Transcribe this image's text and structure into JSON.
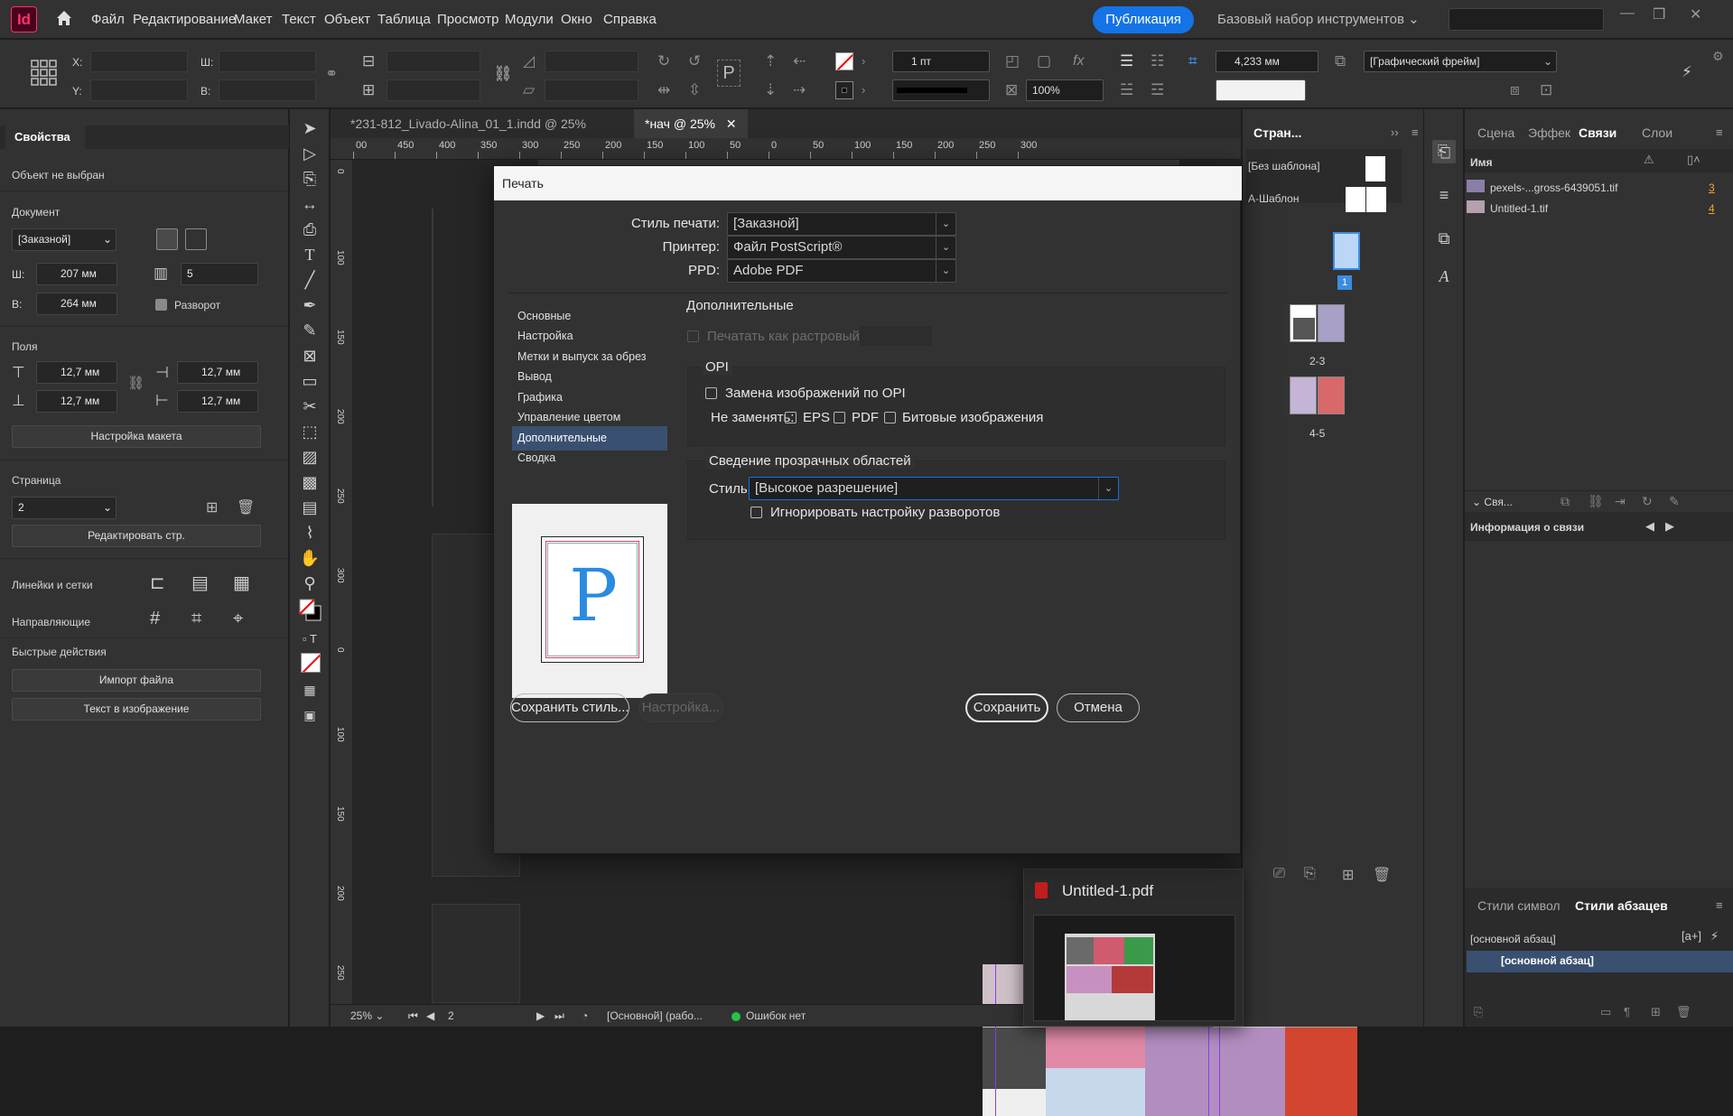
{
  "app": {
    "logo": "Id",
    "accent": "#ff3366"
  },
  "menu": {
    "items": [
      "Файл",
      "Редактирование",
      "Макет",
      "Текст",
      "Объект",
      "Таблица",
      "Просмотр",
      "Модули",
      "Окно",
      "Справка"
    ],
    "publish": "Публикация",
    "workspace": "Базовый набор инструментов"
  },
  "control": {
    "x_label": "X:",
    "y_label": "Y:",
    "w_label": "Ш:",
    "h_label": "В:",
    "stroke_weight": "1 пт",
    "zoom_pct": "100%",
    "gutter": "4,233 мм",
    "frame_style": "[Графический фрейм]"
  },
  "properties": {
    "tab": "Свойства",
    "status": "Объект не выбран",
    "document_heading": "Документ",
    "preset": "[Заказной]",
    "w_label": "Ш:",
    "w_value": "207 мм",
    "h_label": "В:",
    "h_value": "264 мм",
    "pages_value": "5",
    "spread_label": "Разворот",
    "margins_heading": "Поля",
    "margin_top": "12,7 мм",
    "margin_bottom": "12,7 мм",
    "margin_left": "12,7 мм",
    "margin_right": "12,7 мм",
    "layout_btn": "Настройка макета",
    "page_heading": "Страница",
    "page_value": "2",
    "edit_page_btn": "Редактировать стр.",
    "rulers_heading": "Линейки и сетки",
    "guides_heading": "Направляющие",
    "quick_heading": "Быстрые действия",
    "import_btn": "Импорт файла",
    "text_image_btn": "Текст в изображение"
  },
  "tabs": [
    {
      "label": "*231-812_Livado-Alina_01_1.indd @ 25%"
    },
    {
      "label": "*нач @ 25%"
    }
  ],
  "ruler": {
    "h_labels": [
      "00",
      "450",
      "400",
      "350",
      "300",
      "250",
      "200",
      "150",
      "100",
      "50",
      "0",
      "50",
      "100",
      "150",
      "200",
      "250",
      "300"
    ]
  },
  "status": {
    "zoom": "25%",
    "page": "2",
    "style": "[Основной] (рабо...",
    "errors": "Ошибок нет"
  },
  "pages_panel": {
    "title": "Стран...",
    "none_master": "[Без шаблона]",
    "a_master": "А-Шаблон",
    "labels": [
      "1",
      "2-3",
      "4-5"
    ]
  },
  "links_panel": {
    "tabs": [
      "Сцена",
      "Эффек",
      "Связи",
      "Слои"
    ],
    "col_name": "Имя",
    "files": [
      {
        "name": "pexels-...gross-6439051.tif",
        "page": "3"
      },
      {
        "name": "Untitled-1.tif",
        "page": "4"
      }
    ],
    "section_short": "Свя...",
    "link_info": "Информация о связи"
  },
  "styles_panel": {
    "tabs": [
      "Стили символ",
      "Стили абзацев"
    ],
    "current": "[основной абзац]",
    "item": "[основной абзац]"
  },
  "dialog": {
    "title": "Печать",
    "style_label": "Стиль печати:",
    "style_value": "[Заказной]",
    "printer_label": "Принтер:",
    "printer_value": "Файл PostScript®",
    "ppd_label": "PPD:",
    "ppd_value": "Adobe PDF",
    "nav": [
      "Основные",
      "Настройка",
      "Метки и выпуск за обрез",
      "Вывод",
      "Графика",
      "Управление цветом",
      "Дополнительные",
      "Сводка"
    ],
    "section": "Дополнительные",
    "raster_label": "Печатать как растровый",
    "opi_heading": "OPI",
    "opi_replace": "Замена изображений по OPI",
    "dont_replace": "Не заменять:",
    "eps": "EPS",
    "pdf": "PDF",
    "bitmap": "Битовые изображения",
    "flatten_heading": "Сведение прозрачных областей",
    "flatten_style_label": "Стиль:",
    "flatten_style_value": "[Высокое разрешение]",
    "ignore_spread": "Игнорировать настройку разворотов",
    "preview_letter": "P",
    "save_style": "Сохранить стиль...",
    "setup": "Настройка...",
    "save": "Сохранить",
    "cancel": "Отмена"
  },
  "taskbar_preview": {
    "title": "Untitled-1.pdf"
  }
}
